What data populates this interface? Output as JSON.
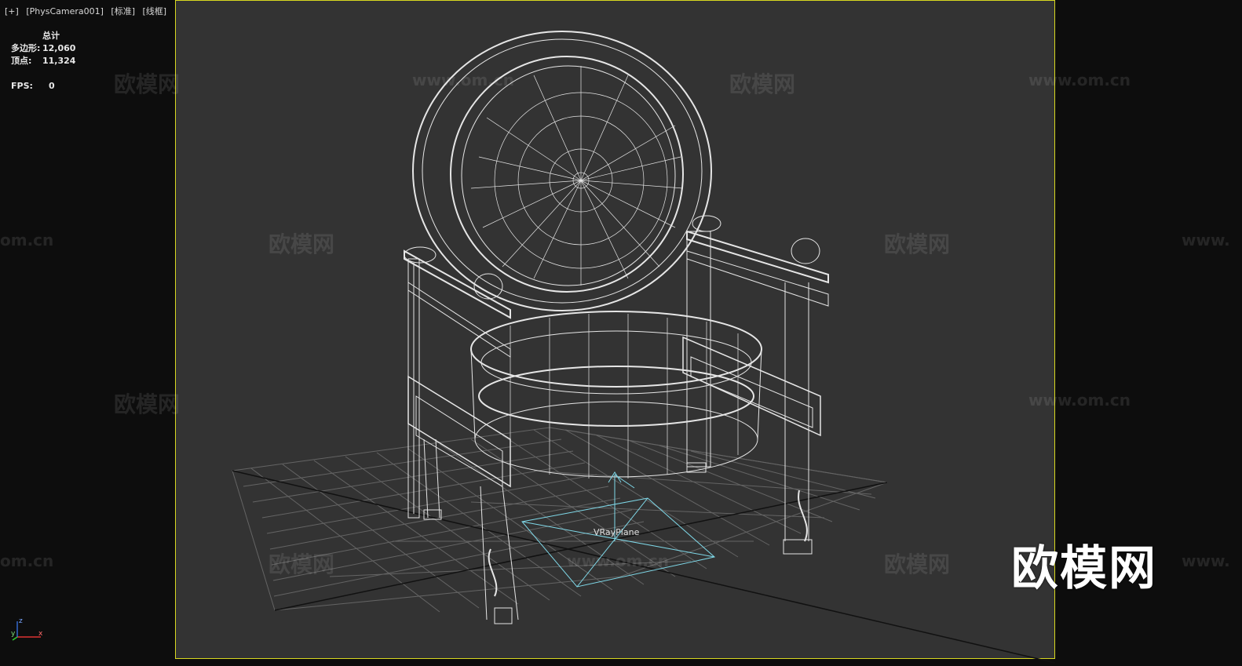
{
  "viewport": {
    "label_plus": "[+]",
    "label_camera": "[PhysCamera001]",
    "label_shading": "[标准]",
    "label_mode": "[线框]"
  },
  "stats": {
    "header": "总计",
    "polygons_label": "多边形:",
    "polygons_value": "12,060",
    "vertices_label": "顶点:",
    "vertices_value": "11,324",
    "fps_label": "FPS:",
    "fps_value": "0"
  },
  "gizmo": {
    "label": "VRayPlane"
  },
  "watermarks": {
    "cn": "欧模网",
    "url": "www.om.cn",
    "url_partial_left": "om.cn",
    "url_partial_right": "www.",
    "brand": "欧模网"
  },
  "axis": {
    "x": "x",
    "y": "y",
    "z": "z"
  },
  "colors": {
    "viewport_bg": "#333333",
    "outer_bg": "#0d0d0d",
    "safe_frame": "#d8d820",
    "wire": "#e6e6e6",
    "gizmo": "#7fd8e8"
  },
  "icons": [
    "axis-tripod-icon"
  ]
}
